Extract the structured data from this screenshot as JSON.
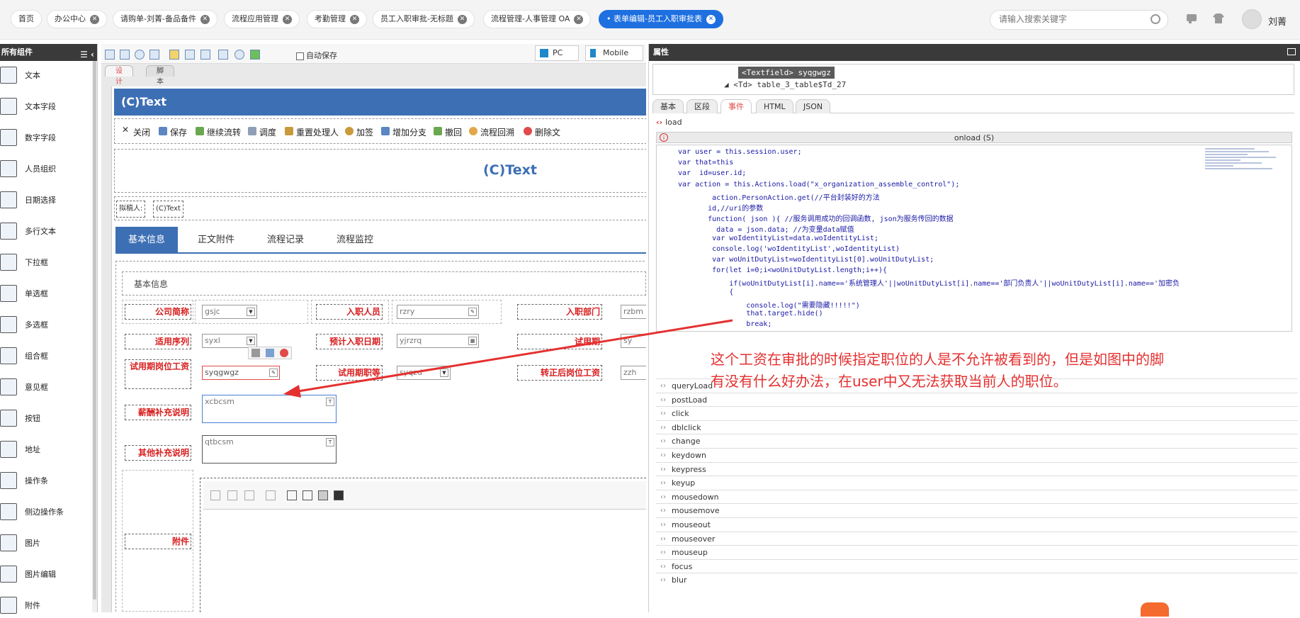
{
  "topbar": {
    "tabs": [
      {
        "label": "首页"
      },
      {
        "label": "办公中心"
      },
      {
        "label": "请购单-刘菁-备品备件"
      },
      {
        "label": "流程应用管理"
      },
      {
        "label": "考勤管理"
      },
      {
        "label": "员工入职审批-无标题"
      },
      {
        "label": "流程管理-人事管理 OA"
      },
      {
        "label": "表单编辑-员工入职审批表",
        "active": true
      }
    ],
    "search_placeholder": "请输入搜索关键字",
    "user_name": "刘菁"
  },
  "left_panel": {
    "title": "所有组件",
    "components": [
      {
        "label": "文本",
        "icon": "text-icon"
      },
      {
        "label": "文本字段",
        "icon": "textfield-icon"
      },
      {
        "label": "数字字段",
        "icon": "number-field-icon"
      },
      {
        "label": "人员组织",
        "icon": "person-org-icon"
      },
      {
        "label": "日期选择",
        "icon": "calendar-icon"
      },
      {
        "label": "多行文本",
        "icon": "textarea-icon"
      },
      {
        "label": "下拉框",
        "icon": "select-icon"
      },
      {
        "label": "单选框",
        "icon": "radio-icon"
      },
      {
        "label": "多选框",
        "icon": "checkbox-icon"
      },
      {
        "label": "组合框",
        "icon": "combobox-icon"
      },
      {
        "label": "意见框",
        "icon": "opinion-icon"
      },
      {
        "label": "按钮",
        "icon": "hand-icon"
      },
      {
        "label": "地址",
        "icon": "location-icon"
      },
      {
        "label": "操作条",
        "icon": "action-bar-icon"
      },
      {
        "label": "侧边操作条",
        "icon": "side-action-bar-icon"
      },
      {
        "label": "图片",
        "icon": "image-icon"
      },
      {
        "label": "图片编辑",
        "icon": "image-edit-icon"
      },
      {
        "label": "附件",
        "icon": "attachment-icon"
      }
    ]
  },
  "center": {
    "autosave_label": "自动保存",
    "device_pc": "PC",
    "device_mobile": "Mobile",
    "tabs": [
      "设计",
      "脚本"
    ],
    "form_header": "(C)Text",
    "form_actions": [
      "关闭",
      "保存",
      "继续流转",
      "调度",
      "重置处理人",
      "加签",
      "增加分支",
      "撤回",
      "流程回溯",
      "删除文"
    ],
    "big_title": "(C)Text",
    "drafter_label": "拟稿人:",
    "drafter_value": "(C)Text",
    "form_tabs": [
      "基本信息",
      "正文附件",
      "流程记录",
      "流程监控"
    ],
    "section_title": "基本信息",
    "fields": {
      "r1": [
        {
          "label": "公司简称",
          "value": "gsjc"
        },
        {
          "label": "入职人员",
          "value": "rzry"
        },
        {
          "label": "入职部门",
          "value": "rzbm"
        }
      ],
      "r2": [
        {
          "label": "适用序列",
          "value": "syxl"
        },
        {
          "label": "预计入职日期",
          "value": "yjrzrq"
        },
        {
          "label": "试用期",
          "value": "sy"
        }
      ],
      "r3": [
        {
          "label": "试用期岗位工资",
          "value": "syqgwgz"
        },
        {
          "label": "试用期职等",
          "value": "syqzd"
        },
        {
          "label": "转正后岗位工资",
          "value": "zzh"
        }
      ],
      "salary_label": "薪酬补充说明",
      "salary_value": "xcbcsm",
      "other_label": "其他补充说明",
      "other_value": "qtbcsm",
      "attachment_label": "附件"
    }
  },
  "right": {
    "title": "属性",
    "tree_selected": "<Textfield> syqgwgz",
    "tree_parent": "<Td> table_3_table$Td_27",
    "tabs": [
      "基本",
      "区段",
      "事件",
      "HTML",
      "JSON"
    ],
    "active_tab": "事件",
    "load_event": "load",
    "editor_title": "onload (S)",
    "code_lines": [
      "var user = this.session.user;",
      "var that=this",
      "var  id=user.id;",
      "var action = this.Actions.load(\"x_organization_assemble_control\");",
      "        action.PersonAction.get(//平台封装好的方法",
      "       id,//uri的参数",
      "       function( json ){ //服务调用成功的回调函数, json为服务传回的数据",
      "         data = json.data; //为变量data赋值",
      "        var woIdentityList=data.woIdentityList;",
      "        console.log('woIdentityList',woIdentityList)",
      "        var woUnitDutyList=woIdentityList[0].woUnitDutyList;",
      "        for(let i=0;i<woUnitDutyList.length;i++){",
      "            if(woUnitDutyList[i].name=='系统管理人'||woUnitDutyList[i].name=='部门负责人'||woUnitDutyList[i].name=='加密负",
      "            {",
      "                console.log(\"需要隐藏!!!!!\")",
      "                that.target.hide()",
      "                break;"
    ],
    "events": [
      "queryLoad",
      "postLoad",
      "click",
      "dblclick",
      "change",
      "keydown",
      "keypress",
      "keyup",
      "mousedown",
      "mousemove",
      "mouseout",
      "mouseover",
      "mouseup",
      "focus",
      "blur"
    ]
  },
  "annotation": {
    "line1": "这个工资在审批的时候指定职位的人是不允许被看到的，但是如图中的脚",
    "line2": "有没有什么好办法，在user中又无法获取当前人的职位。",
    "color": "#e53030"
  }
}
